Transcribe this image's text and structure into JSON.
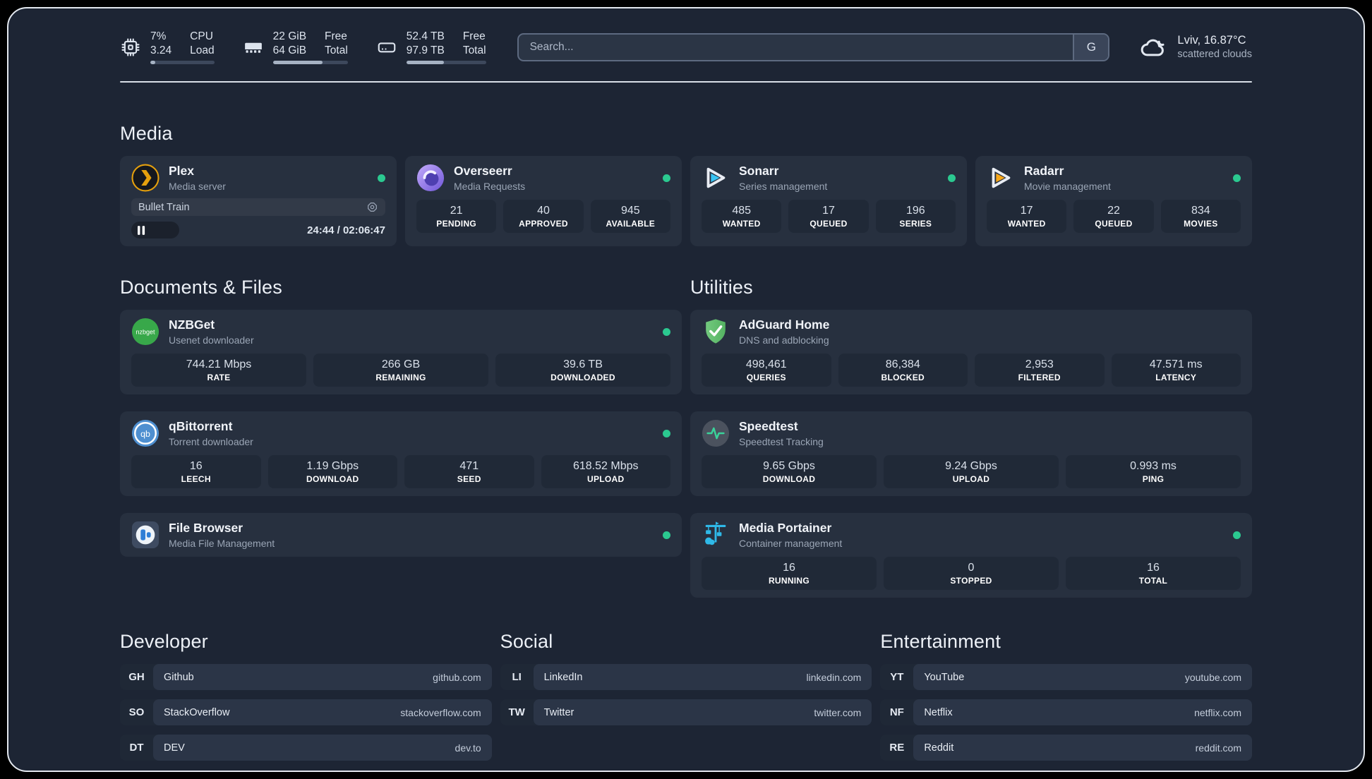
{
  "topbar": {
    "resources": [
      {
        "icon": "cpu",
        "values": [
          "7%",
          "3.24"
        ],
        "labels": [
          "CPU",
          "Load"
        ],
        "progress": 8
      },
      {
        "icon": "memory",
        "values": [
          "22 GiB",
          "64 GiB"
        ],
        "labels": [
          "Free",
          "Total"
        ],
        "progress": 66
      },
      {
        "icon": "disk",
        "values": [
          "52.4 TB",
          "97.9 TB"
        ],
        "labels": [
          "Free",
          "Total"
        ],
        "progress": 47
      }
    ],
    "search": {
      "placeholder": "Search...",
      "provider": "G"
    },
    "weather": {
      "line1": "Lviv, 16.87°C",
      "line2": "scattered clouds"
    }
  },
  "colors": {
    "status_ok": "#2bc990",
    "plex_accent": "#e5a00d",
    "card_bg": "#27303f",
    "page_bg": "#1d2534"
  },
  "media": {
    "title": "Media",
    "plex": {
      "name": "Plex",
      "desc": "Media server",
      "now_playing": "Bullet Train",
      "time": "24:44 / 02:06:47",
      "progress": 19
    },
    "overseerr": {
      "name": "Overseerr",
      "desc": "Media Requests",
      "stats": [
        {
          "value": "21",
          "label": "PENDING"
        },
        {
          "value": "40",
          "label": "APPROVED"
        },
        {
          "value": "945",
          "label": "AVAILABLE"
        }
      ]
    },
    "sonarr": {
      "name": "Sonarr",
      "desc": "Series management",
      "stats": [
        {
          "value": "485",
          "label": "WANTED"
        },
        {
          "value": "17",
          "label": "QUEUED"
        },
        {
          "value": "196",
          "label": "SERIES"
        }
      ]
    },
    "radarr": {
      "name": "Radarr",
      "desc": "Movie management",
      "stats": [
        {
          "value": "17",
          "label": "WANTED"
        },
        {
          "value": "22",
          "label": "QUEUED"
        },
        {
          "value": "834",
          "label": "MOVIES"
        }
      ]
    }
  },
  "documents": {
    "title": "Documents & Files",
    "nzbget": {
      "name": "NZBGet",
      "desc": "Usenet downloader",
      "icon_text": "nzbget",
      "stats": [
        {
          "value": "744.21 Mbps",
          "label": "RATE"
        },
        {
          "value": "266 GB",
          "label": "REMAINING"
        },
        {
          "value": "39.6 TB",
          "label": "DOWNLOADED"
        }
      ]
    },
    "qbittorrent": {
      "name": "qBittorrent",
      "desc": "Torrent downloader",
      "icon_text": "qb",
      "stats": [
        {
          "value": "16",
          "label": "LEECH"
        },
        {
          "value": "1.19 Gbps",
          "label": "DOWNLOAD"
        },
        {
          "value": "471",
          "label": "SEED"
        },
        {
          "value": "618.52 Mbps",
          "label": "UPLOAD"
        }
      ]
    },
    "filebrowser": {
      "name": "File Browser",
      "desc": "Media File Management"
    }
  },
  "utilities": {
    "title": "Utilities",
    "adguard": {
      "name": "AdGuard Home",
      "desc": "DNS and adblocking",
      "stats": [
        {
          "value": "498,461",
          "label": "QUERIES"
        },
        {
          "value": "86,384",
          "label": "BLOCKED"
        },
        {
          "value": "2,953",
          "label": "FILTERED"
        },
        {
          "value": "47.571 ms",
          "label": "LATENCY"
        }
      ]
    },
    "speedtest": {
      "name": "Speedtest",
      "desc": "Speedtest Tracking",
      "stats": [
        {
          "value": "9.65 Gbps",
          "label": "DOWNLOAD"
        },
        {
          "value": "9.24 Gbps",
          "label": "UPLOAD"
        },
        {
          "value": "0.993 ms",
          "label": "PING"
        }
      ]
    },
    "portainer": {
      "name": "Media Portainer",
      "desc": "Container management",
      "stats": [
        {
          "value": "16",
          "label": "RUNNING"
        },
        {
          "value": "0",
          "label": "STOPPED"
        },
        {
          "value": "16",
          "label": "TOTAL"
        }
      ]
    }
  },
  "bookmarks": {
    "developer": {
      "title": "Developer",
      "items": [
        {
          "abbr": "GH",
          "name": "Github",
          "url": "github.com"
        },
        {
          "abbr": "SO",
          "name": "StackOverflow",
          "url": "stackoverflow.com"
        },
        {
          "abbr": "DT",
          "name": "DEV",
          "url": "dev.to"
        }
      ]
    },
    "social": {
      "title": "Social",
      "items": [
        {
          "abbr": "LI",
          "name": "LinkedIn",
          "url": "linkedin.com"
        },
        {
          "abbr": "TW",
          "name": "Twitter",
          "url": "twitter.com"
        }
      ]
    },
    "entertainment": {
      "title": "Entertainment",
      "items": [
        {
          "abbr": "YT",
          "name": "YouTube",
          "url": "youtube.com"
        },
        {
          "abbr": "NF",
          "name": "Netflix",
          "url": "netflix.com"
        },
        {
          "abbr": "RE",
          "name": "Reddit",
          "url": "reddit.com"
        }
      ]
    }
  }
}
